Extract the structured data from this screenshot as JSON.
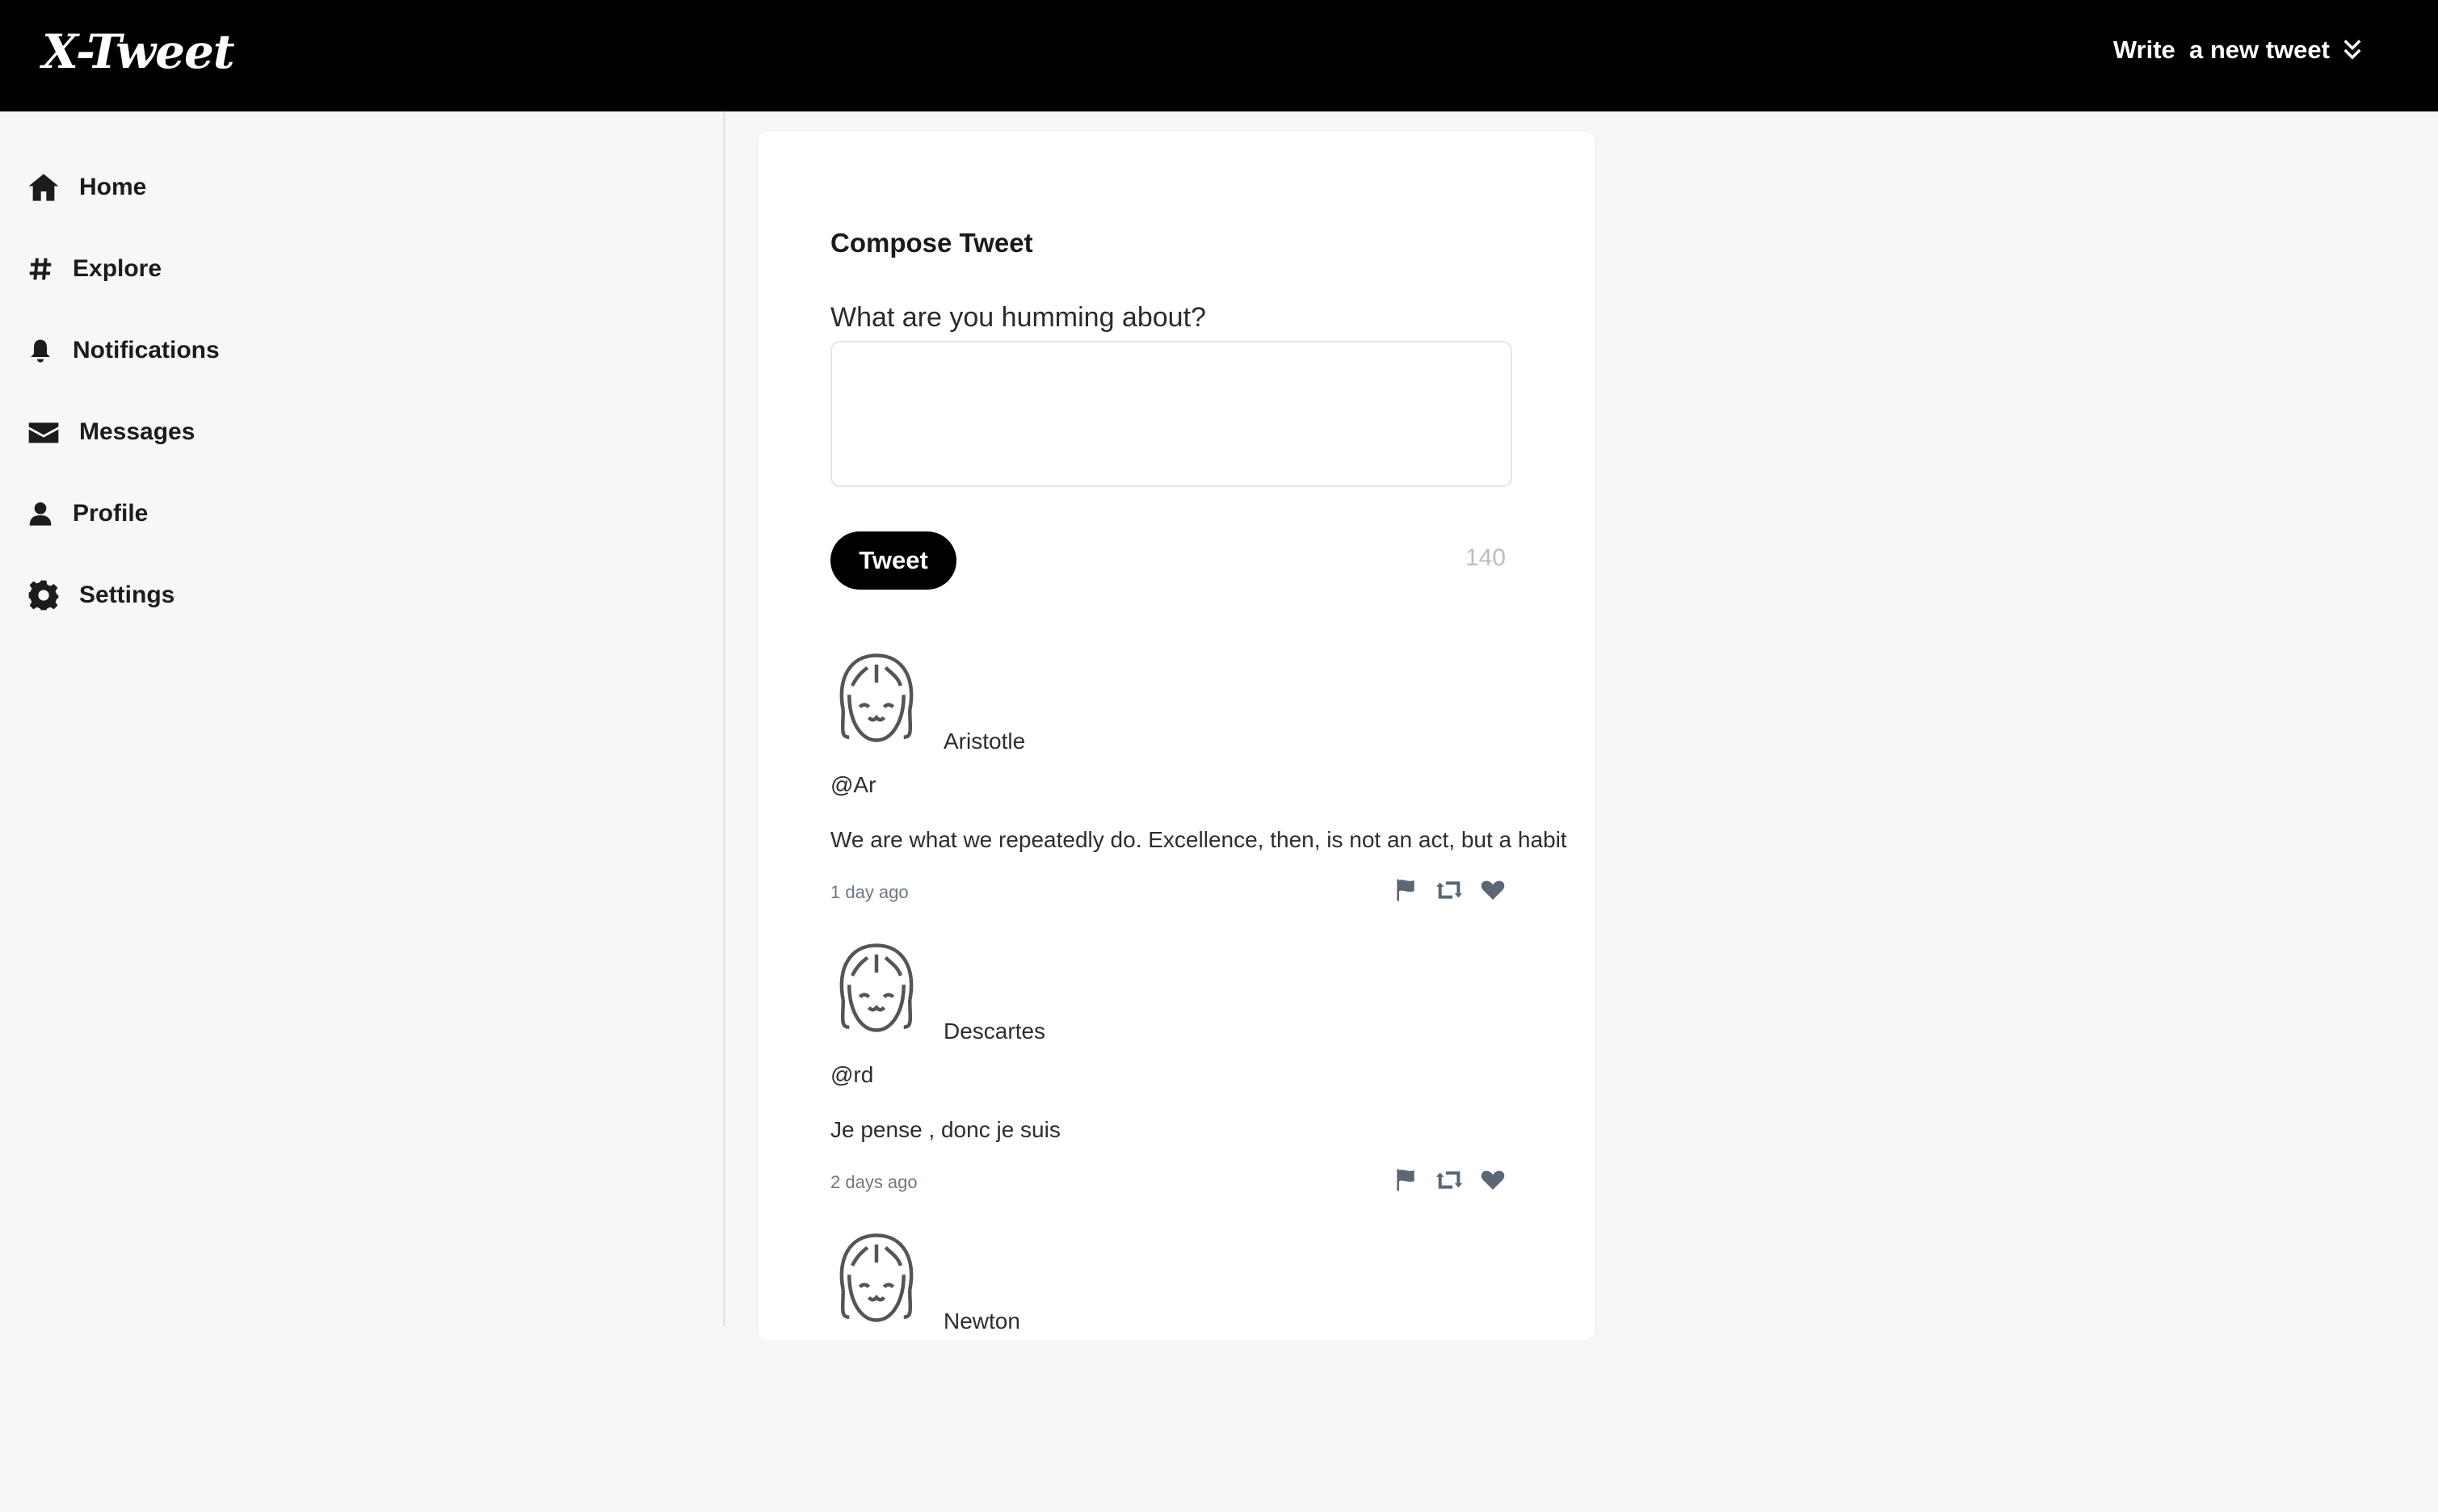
{
  "header": {
    "logo": "X-Tweet",
    "write_label": "Write  a new tweet",
    "write_icon": "double-chevron-down-icon"
  },
  "sidebar": {
    "items": [
      {
        "label": "Home",
        "icon": "home-icon"
      },
      {
        "label": "Explore",
        "icon": "hashtag-icon"
      },
      {
        "label": "Notifications",
        "icon": "bell-icon"
      },
      {
        "label": "Messages",
        "icon": "envelope-icon"
      },
      {
        "label": "Profile",
        "icon": "user-icon"
      },
      {
        "label": "Settings",
        "icon": "gear-icon"
      }
    ]
  },
  "compose": {
    "title": "Compose Tweet",
    "label": "What are you humming about?",
    "value": "",
    "button": "Tweet",
    "char_count": "140"
  },
  "tweets": [
    {
      "author": "Aristotle",
      "handle": "@Ar",
      "text": "We are what we repeatedly do. Excellence, then, is not an act, but a habit",
      "time": "1 day ago"
    },
    {
      "author": "Descartes",
      "handle": "@rd",
      "text": "Je pense , donc je suis",
      "time": "2 days ago"
    },
    {
      "author": "Newton",
      "handle": "",
      "text": "",
      "time": ""
    }
  ],
  "colors": {
    "topbar": "#000000",
    "sidebar_bg": "#f6f8f7",
    "card_bg": "#ffffff",
    "action_icons": "#5b6776",
    "muted_text": "#6d7783"
  }
}
